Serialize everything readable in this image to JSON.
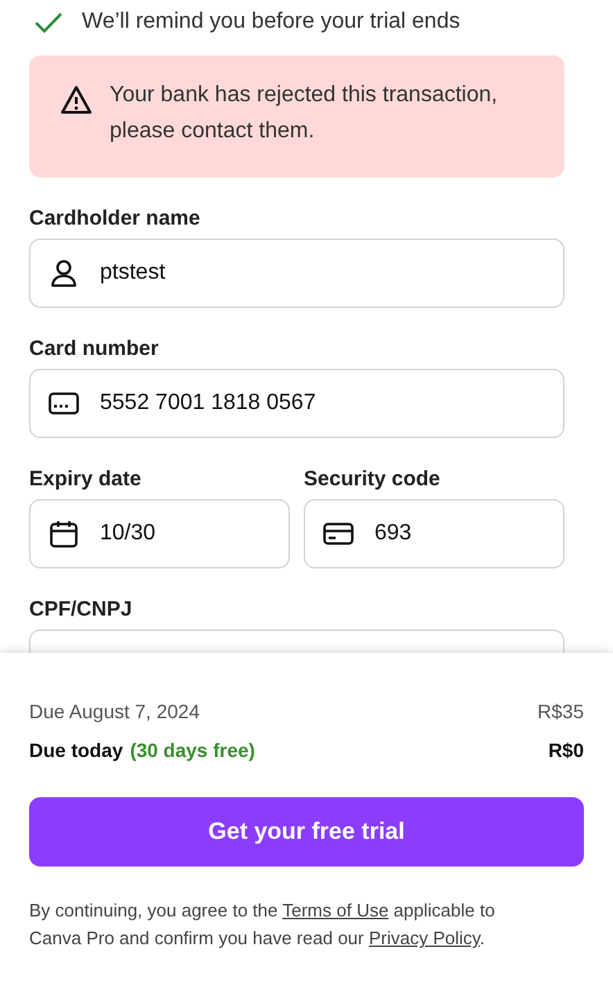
{
  "notice": {
    "text": "We’ll remind you before your trial ends"
  },
  "alert": {
    "text": "Your bank has rejected this transaction, please contact them."
  },
  "form_rows": [
    [
      {
        "label": "Cardholder name",
        "value": "ptstest",
        "kind": "person"
      }
    ],
    [
      {
        "label": "Card number",
        "value": "5552 7001 1818 0567",
        "kind": "card"
      }
    ],
    [
      {
        "label": "Expiry date",
        "value": "10/30",
        "kind": "calendar"
      },
      {
        "label": "Security code",
        "value": "693",
        "kind": "cvc"
      }
    ],
    [
      {
        "label": "CPF/CNPJ"
      }
    ]
  ],
  "summary": [
    {
      "kind": "later",
      "label": "Due August 7, 2024",
      "amount": "R$35"
    },
    {
      "kind": "today",
      "label": "Due today",
      "note": "(30 days free)",
      "amount": "R$0"
    }
  ],
  "button": {
    "label": "Get your free trial"
  },
  "legal": {
    "before": "By continuing, you agree to the ",
    "terms": "Terms of Use",
    "middle": " applicable to Canva Pro and confirm you have read our ",
    "privacy": "Privacy Policy",
    "after": "."
  }
}
